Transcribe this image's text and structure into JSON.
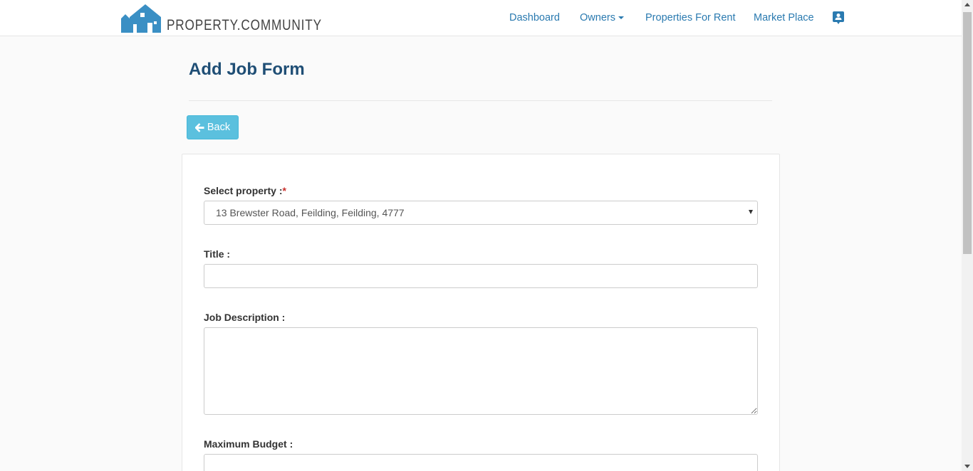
{
  "brand": {
    "logo_text": "PROPERTY.COMMUNITY",
    "logo_color": "#3a8fc4"
  },
  "nav": {
    "dashboard": "Dashboard",
    "owners": "Owners",
    "properties_for_rent": "Properties For Rent",
    "market_place": "Market Place",
    "profile_icon": "contact-card-icon",
    "link_color": "#2a7ab0"
  },
  "page": {
    "title": "Add Job Form",
    "back_label": "Back",
    "back_icon": "arrow-left-icon",
    "back_color": "#5bc0de"
  },
  "form": {
    "property": {
      "label": "Select property :",
      "required_mark": "*",
      "selected": "13 Brewster Road, Feilding, Feilding, 4777"
    },
    "title": {
      "label": "Title :",
      "value": ""
    },
    "description": {
      "label": "Job Description :",
      "value": ""
    },
    "budget": {
      "label": "Maximum Budget :",
      "value": ""
    }
  }
}
